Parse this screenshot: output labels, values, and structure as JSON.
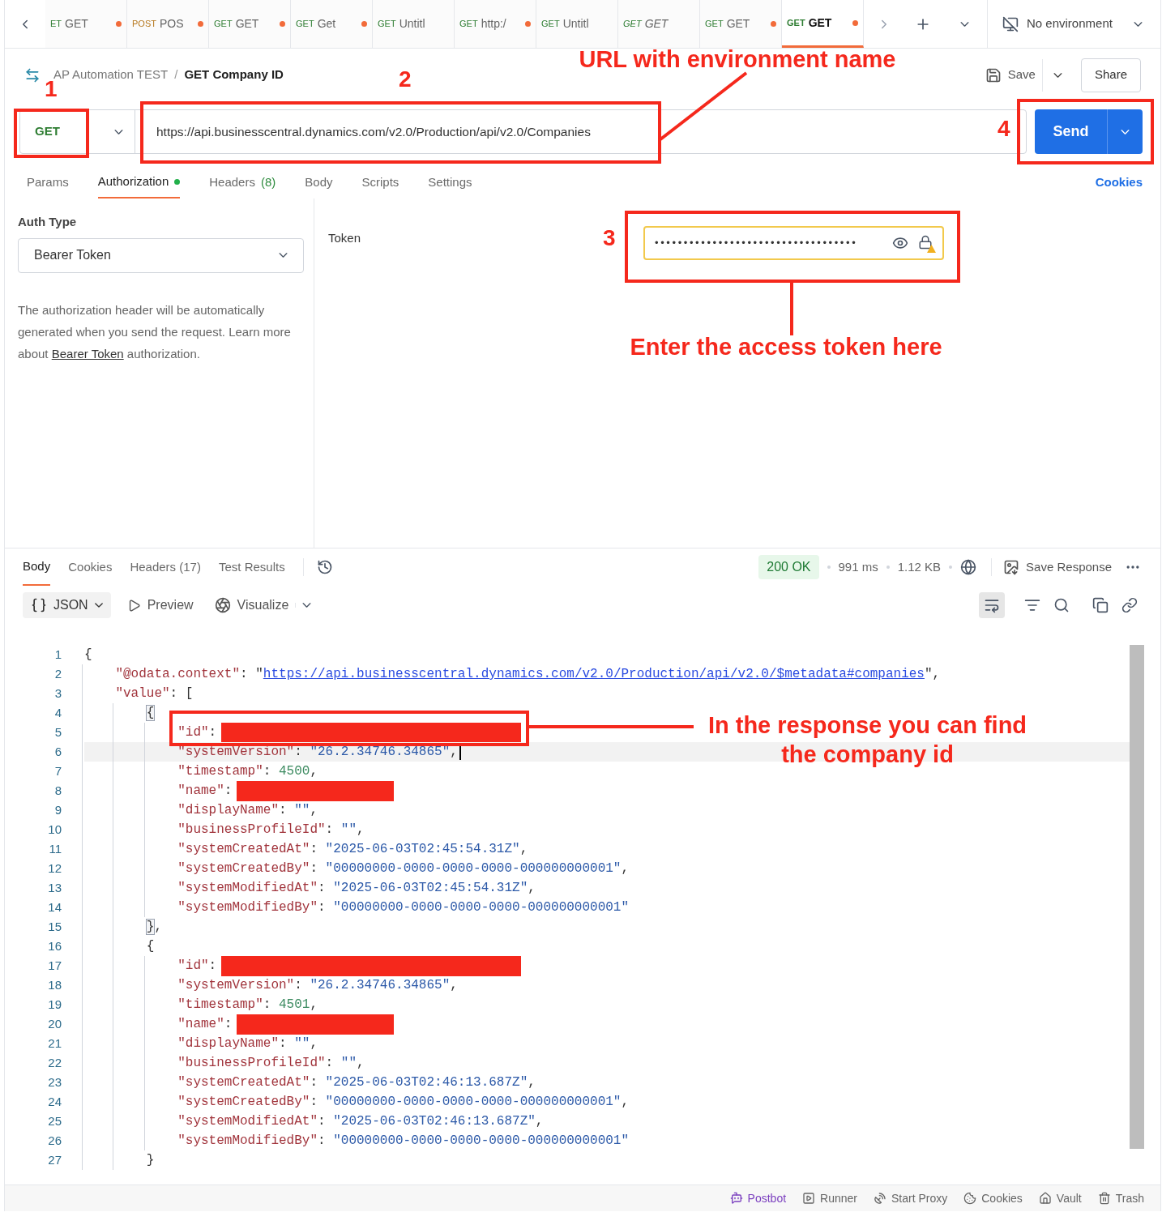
{
  "tabs": [
    {
      "method": "ET",
      "kind": "get",
      "name": "GET",
      "unsaved": true,
      "preview": false,
      "selected": false
    },
    {
      "method": "POST",
      "kind": "post",
      "name": "POS",
      "unsaved": true,
      "preview": false,
      "selected": false
    },
    {
      "method": "GET",
      "kind": "get",
      "name": "GET",
      "unsaved": true,
      "preview": false,
      "selected": false
    },
    {
      "method": "GET",
      "kind": "get",
      "name": "Get",
      "unsaved": true,
      "preview": false,
      "selected": false
    },
    {
      "method": "GET",
      "kind": "get",
      "name": "Untitl",
      "unsaved": false,
      "preview": false,
      "selected": false
    },
    {
      "method": "GET",
      "kind": "get",
      "name": "http:/",
      "unsaved": true,
      "preview": false,
      "selected": false
    },
    {
      "method": "GET",
      "kind": "get",
      "name": "Untitl",
      "unsaved": false,
      "preview": false,
      "selected": false
    },
    {
      "method": "GET",
      "kind": "get",
      "name": "GET",
      "unsaved": false,
      "preview": true,
      "selected": false
    },
    {
      "method": "GET",
      "kind": "get",
      "name": "GET",
      "unsaved": true,
      "preview": false,
      "selected": false
    },
    {
      "method": "GET",
      "kind": "get",
      "name": "GET",
      "unsaved": true,
      "preview": false,
      "selected": true
    }
  ],
  "environment": "No environment",
  "breadcrumb": {
    "collection": "AP Automation TEST",
    "separator": "/",
    "request": "GET Company ID"
  },
  "save": "Save",
  "share": "Share",
  "request": {
    "method": "GET",
    "url": "https://api.businesscentral.dynamics.com/v2.0/Production/api/v2.0/Companies",
    "send": "Send"
  },
  "request_tabs": [
    {
      "label": "Params",
      "selected": false,
      "dot": false
    },
    {
      "label": "Authorization",
      "selected": true,
      "dot": true
    },
    {
      "label": "Headers",
      "count": "(8)",
      "selected": false,
      "dot": false
    },
    {
      "label": "Body",
      "selected": false,
      "dot": false
    },
    {
      "label": "Scripts",
      "selected": false,
      "dot": false
    },
    {
      "label": "Settings",
      "selected": false,
      "dot": false
    }
  ],
  "cookies_link": "Cookies",
  "auth": {
    "type_label": "Auth Type",
    "type": "Bearer Token",
    "description": "The authorization header will be automatically generated when you send the request. Learn more about",
    "link": "Bearer Token",
    "description_end": "authorization.",
    "token_label": "Token",
    "token_value": "•••••••••••••••••••••••••••••••••••"
  },
  "response": {
    "tabs": [
      {
        "label": "Body",
        "selected": true
      },
      {
        "label": "Cookies",
        "selected": false
      },
      {
        "label": "Headers (17)",
        "selected": false
      },
      {
        "label": "Test Results",
        "selected": false
      }
    ],
    "status": "200 OK",
    "time": "991 ms",
    "size": "1.12 KB",
    "save_response": "Save Response",
    "format": "JSON",
    "preview": "Preview",
    "visualize": "Visualize",
    "wrap_on": true
  },
  "code": [
    {
      "num": "1",
      "current": false,
      "tokens": [
        {
          "kind": "p",
          "text": "{"
        }
      ],
      "children": [
        {
          "num": "2",
          "current": false,
          "tokens": [
            {
              "kind": "k",
              "text": "\"@odata.context\""
            },
            {
              "kind": "p",
              "text": ": \""
            },
            {
              "kind": "l",
              "text": "https://api.businesscentral.dynamics.com/v2.0/Production/api/v2.0/$metadata#companies"
            },
            {
              "kind": "p",
              "text": "\","
            }
          ]
        },
        {
          "num": "3",
          "current": false,
          "tokens": [
            {
              "kind": "k",
              "text": "\"value\""
            },
            {
              "kind": "p",
              "text": ": ["
            }
          ],
          "children": [
            {
              "num": "4",
              "current": false,
              "tokens": [
                {
                  "kind": "m",
                  "text": "{"
                }
              ],
              "children": [
                {
                  "num": "5",
                  "current": false,
                  "tokens": [
                    {
                      "kind": "k",
                      "text": "\"id\""
                    },
                    {
                      "kind": "p",
                      "text": ":"
                    },
                    {
                      "kind": "rl"
                    }
                  ]
                },
                {
                  "num": "6",
                  "current": true,
                  "tokens": [
                    {
                      "kind": "k",
                      "text": "\"systemVersion\""
                    },
                    {
                      "kind": "p",
                      "text": ": "
                    },
                    {
                      "kind": "s",
                      "text": "\"26.2.34746.34865\""
                    },
                    {
                      "kind": "p",
                      "text": ","
                    }
                  ]
                },
                {
                  "num": "7",
                  "current": false,
                  "tokens": [
                    {
                      "kind": "k",
                      "text": "\"timestamp\""
                    },
                    {
                      "kind": "p",
                      "text": ": "
                    },
                    {
                      "kind": "n",
                      "text": "4500"
                    },
                    {
                      "kind": "p",
                      "text": ","
                    }
                  ]
                },
                {
                  "num": "8",
                  "current": false,
                  "tokens": [
                    {
                      "kind": "k",
                      "text": "\"name\""
                    },
                    {
                      "kind": "p",
                      "text": ":"
                    },
                    {
                      "kind": "rs"
                    }
                  ]
                },
                {
                  "num": "9",
                  "current": false,
                  "tokens": [
                    {
                      "kind": "k",
                      "text": "\"displayName\""
                    },
                    {
                      "kind": "p",
                      "text": ": "
                    },
                    {
                      "kind": "s",
                      "text": "\"\""
                    },
                    {
                      "kind": "p",
                      "text": ","
                    }
                  ]
                },
                {
                  "num": "10",
                  "current": false,
                  "tokens": [
                    {
                      "kind": "k",
                      "text": "\"businessProfileId\""
                    },
                    {
                      "kind": "p",
                      "text": ": "
                    },
                    {
                      "kind": "s",
                      "text": "\"\""
                    },
                    {
                      "kind": "p",
                      "text": ","
                    }
                  ]
                },
                {
                  "num": "11",
                  "current": false,
                  "tokens": [
                    {
                      "kind": "k",
                      "text": "\"systemCreatedAt\""
                    },
                    {
                      "kind": "p",
                      "text": ": "
                    },
                    {
                      "kind": "s",
                      "text": "\"2025-06-03T02:45:54.31Z\""
                    },
                    {
                      "kind": "p",
                      "text": ","
                    }
                  ]
                },
                {
                  "num": "12",
                  "current": false,
                  "tokens": [
                    {
                      "kind": "k",
                      "text": "\"systemCreatedBy\""
                    },
                    {
                      "kind": "p",
                      "text": ": "
                    },
                    {
                      "kind": "s",
                      "text": "\"00000000-0000-0000-0000-000000000001\""
                    },
                    {
                      "kind": "p",
                      "text": ","
                    }
                  ]
                },
                {
                  "num": "13",
                  "current": false,
                  "tokens": [
                    {
                      "kind": "k",
                      "text": "\"systemModifiedAt\""
                    },
                    {
                      "kind": "p",
                      "text": ": "
                    },
                    {
                      "kind": "s",
                      "text": "\"2025-06-03T02:45:54.31Z\""
                    },
                    {
                      "kind": "p",
                      "text": ","
                    }
                  ]
                },
                {
                  "num": "14",
                  "current": false,
                  "tokens": [
                    {
                      "kind": "k",
                      "text": "\"systemModifiedBy\""
                    },
                    {
                      "kind": "p",
                      "text": ": "
                    },
                    {
                      "kind": "s",
                      "text": "\"00000000-0000-0000-0000-000000000001\""
                    }
                  ]
                }
              ]
            },
            {
              "num": "15",
              "current": false,
              "tokens": [
                {
                  "kind": "m",
                  "text": "}"
                },
                {
                  "kind": "p",
                  "text": ","
                }
              ]
            },
            {
              "num": "16",
              "current": false,
              "tokens": [
                {
                  "kind": "p",
                  "text": "{"
                }
              ],
              "children": [
                {
                  "num": "17",
                  "current": false,
                  "tokens": [
                    {
                      "kind": "k",
                      "text": "\"id\""
                    },
                    {
                      "kind": "p",
                      "text": ":"
                    },
                    {
                      "kind": "rl"
                    }
                  ]
                },
                {
                  "num": "18",
                  "current": false,
                  "tokens": [
                    {
                      "kind": "k",
                      "text": "\"systemVersion\""
                    },
                    {
                      "kind": "p",
                      "text": ": "
                    },
                    {
                      "kind": "s",
                      "text": "\"26.2.34746.34865\""
                    },
                    {
                      "kind": "p",
                      "text": ","
                    }
                  ]
                },
                {
                  "num": "19",
                  "current": false,
                  "tokens": [
                    {
                      "kind": "k",
                      "text": "\"timestamp\""
                    },
                    {
                      "kind": "p",
                      "text": ": "
                    },
                    {
                      "kind": "n",
                      "text": "4501"
                    },
                    {
                      "kind": "p",
                      "text": ","
                    }
                  ]
                },
                {
                  "num": "20",
                  "current": false,
                  "tokens": [
                    {
                      "kind": "k",
                      "text": "\"name\""
                    },
                    {
                      "kind": "p",
                      "text": ":"
                    },
                    {
                      "kind": "rs"
                    }
                  ]
                },
                {
                  "num": "21",
                  "current": false,
                  "tokens": [
                    {
                      "kind": "k",
                      "text": "\"displayName\""
                    },
                    {
                      "kind": "p",
                      "text": ": "
                    },
                    {
                      "kind": "s",
                      "text": "\"\""
                    },
                    {
                      "kind": "p",
                      "text": ","
                    }
                  ]
                },
                {
                  "num": "22",
                  "current": false,
                  "tokens": [
                    {
                      "kind": "k",
                      "text": "\"businessProfileId\""
                    },
                    {
                      "kind": "p",
                      "text": ": "
                    },
                    {
                      "kind": "s",
                      "text": "\"\""
                    },
                    {
                      "kind": "p",
                      "text": ","
                    }
                  ]
                },
                {
                  "num": "23",
                  "current": false,
                  "tokens": [
                    {
                      "kind": "k",
                      "text": "\"systemCreatedAt\""
                    },
                    {
                      "kind": "p",
                      "text": ": "
                    },
                    {
                      "kind": "s",
                      "text": "\"2025-06-03T02:46:13.687Z\""
                    },
                    {
                      "kind": "p",
                      "text": ","
                    }
                  ]
                },
                {
                  "num": "24",
                  "current": false,
                  "tokens": [
                    {
                      "kind": "k",
                      "text": "\"systemCreatedBy\""
                    },
                    {
                      "kind": "p",
                      "text": ": "
                    },
                    {
                      "kind": "s",
                      "text": "\"00000000-0000-0000-0000-000000000001\""
                    },
                    {
                      "kind": "p",
                      "text": ","
                    }
                  ]
                },
                {
                  "num": "25",
                  "current": false,
                  "tokens": [
                    {
                      "kind": "k",
                      "text": "\"systemModifiedAt\""
                    },
                    {
                      "kind": "p",
                      "text": ": "
                    },
                    {
                      "kind": "s",
                      "text": "\"2025-06-03T02:46:13.687Z\""
                    },
                    {
                      "kind": "p",
                      "text": ","
                    }
                  ]
                },
                {
                  "num": "26",
                  "current": false,
                  "tokens": [
                    {
                      "kind": "k",
                      "text": "\"systemModifiedBy\""
                    },
                    {
                      "kind": "p",
                      "text": ": "
                    },
                    {
                      "kind": "s",
                      "text": "\"00000000-0000-0000-0000-000000000001\""
                    }
                  ]
                }
              ]
            },
            {
              "num": "27",
              "current": false,
              "tokens": [
                {
                  "kind": "p",
                  "text": "}"
                }
              ]
            }
          ]
        }
      ]
    }
  ],
  "status_bar": [
    {
      "label": "Postbot",
      "kind": "postbot"
    },
    {
      "label": "Runner",
      "kind": "runner"
    },
    {
      "label": "Start Proxy",
      "kind": "proxy"
    },
    {
      "label": "Cookies",
      "kind": "cookies"
    },
    {
      "label": "Vault",
      "kind": "vault"
    },
    {
      "label": "Trash",
      "kind": "trash"
    }
  ],
  "annotations": {
    "numbers": [
      "1",
      "2",
      "3",
      "4"
    ],
    "callouts": [
      {
        "lines": [
          "URL with environment name"
        ]
      },
      {
        "lines": [
          "Enter the access token here"
        ]
      },
      {
        "lines": [
          "In the response you can find",
          "the company id"
        ]
      }
    ]
  }
}
